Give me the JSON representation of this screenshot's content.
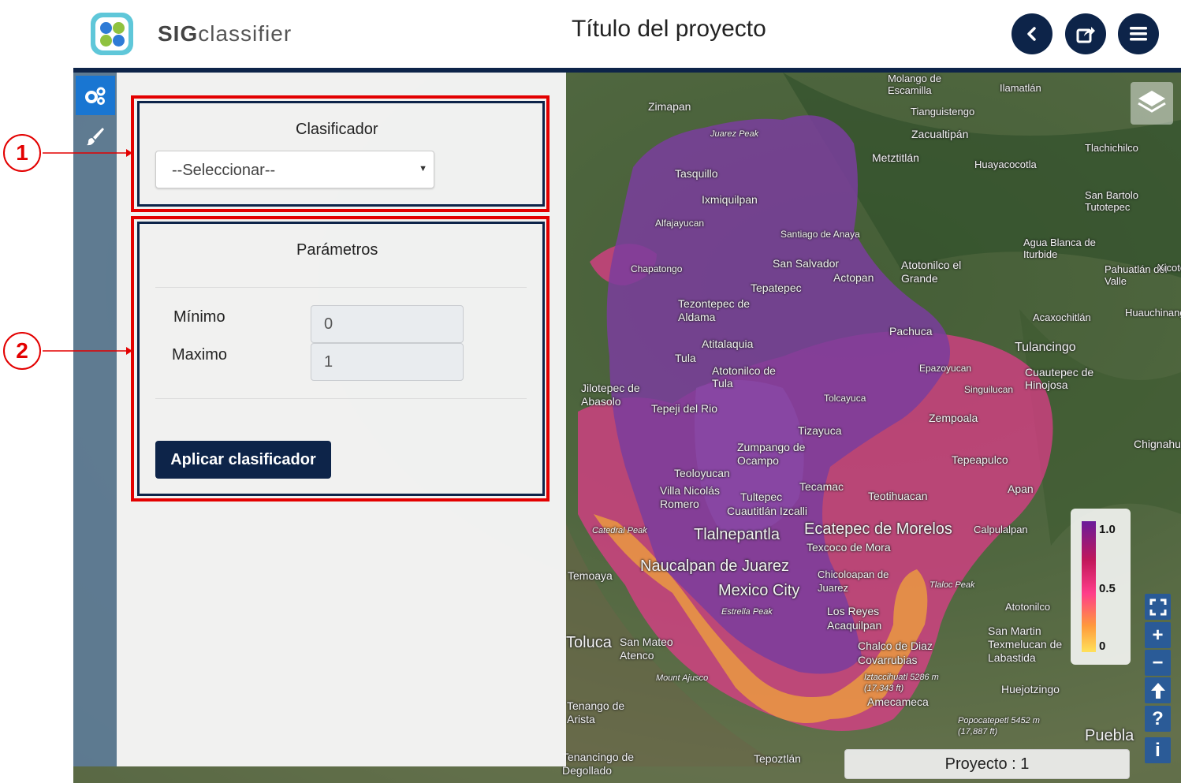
{
  "header": {
    "brand_prefix": "SIG",
    "brand_suffix": "classifier",
    "project_title": "Título del proyecto",
    "buttons": [
      "back-icon",
      "share-icon",
      "menu-icon"
    ],
    "accent_color": "#0d2449"
  },
  "toolbar": {
    "items": [
      {
        "icon": "gears-icon",
        "active": true
      },
      {
        "icon": "brush-icon",
        "active": false
      }
    ],
    "active_color": "#1976d2"
  },
  "panel": {
    "classifier": {
      "title": "Clasificador",
      "select_value": "--Seleccionar--"
    },
    "parameters": {
      "title": "Parámetros",
      "min_label": "Mínimo",
      "min_value": "0",
      "max_label": "Maximo",
      "max_value": "1",
      "apply_label": "Aplicar clasificador"
    }
  },
  "callouts": [
    "1",
    "2"
  ],
  "map": {
    "places": [
      "Zimapan",
      "Juarez Peak",
      "Tasquillo",
      "Ixmiquilpan",
      "Alfajayucan",
      "Santiago de Anaya",
      "Chapatongo",
      "San Salvador",
      "Actopan",
      "Tepatepec",
      "Tezontepec de Aldama",
      "Atitalaquia",
      "Tula",
      "Atotonilco de Tula",
      "Jilotepec de Abasolo",
      "Tepeji del Rio",
      "Tolcayuca",
      "Tizayuca",
      "Zumpango de Ocampo",
      "Teoloyucan",
      "Tecamac",
      "Teotihuacan",
      "Villa Nicolás Romero",
      "Tultepec",
      "Cuautitlán Izcalli",
      "Tlalnepantla",
      "Ecatepec de Morelos",
      "Texcoco de Mora",
      "Naucalpan de Juarez",
      "Mexico City",
      "Chicoloapan de Juarez",
      "Los Reyes Acaquilpan",
      "Chalco de Diaz Covarrubias",
      "Toluca",
      "San Mateo Atenco",
      "Temoaya",
      "Pachuca",
      "Epazoyucan",
      "Singuilucan",
      "Zempoala",
      "Tepeapulco",
      "Apan",
      "Calpulalpan",
      "Tulancingo",
      "Cuautepec de Hinojosa",
      "Atotonilco el Grande",
      "Metztitlán",
      "Zacualtipán",
      "Tianguistengo",
      "Huayacocotla",
      "Tlachichilco",
      "San Bartolo Tutotepec",
      "Agua Blanca de Iturbide",
      "Pahuatlán del Valle",
      "Acaxochitlán",
      "Atotonilco",
      "San Martin Texmelucan de Labastida",
      "Huejotzingo",
      "Puebla",
      "Tepoztlán",
      "Tenancingo de Degollado",
      "Tenango de Arista",
      "Molango de Escamilla",
      "Ilamatlán",
      "Iztaccihuatl 5286 m (17,343 ft)",
      "Amecameca",
      "Popocatepetl 5452 m (17,887 ft)",
      "Tlaloc Peak",
      "Catedral Peak",
      "Estrella Peak",
      "Mount Ajusco",
      "Chignahuapan",
      "Huauchinango",
      "Xicotepec"
    ]
  },
  "legend": {
    "max": "1.0",
    "mid": "0.5",
    "min": "0",
    "gradient": [
      "#6a1b9a",
      "#c2185b",
      "#ff3d8a",
      "#ff9a3c",
      "#ffe15a"
    ]
  },
  "map_controls": [
    "fullscreen-icon",
    "zoom-in-icon",
    "zoom-out-icon",
    "north-arrow-icon",
    "help-icon",
    "info-icon"
  ],
  "status": {
    "text": "Proyecto : 1"
  }
}
